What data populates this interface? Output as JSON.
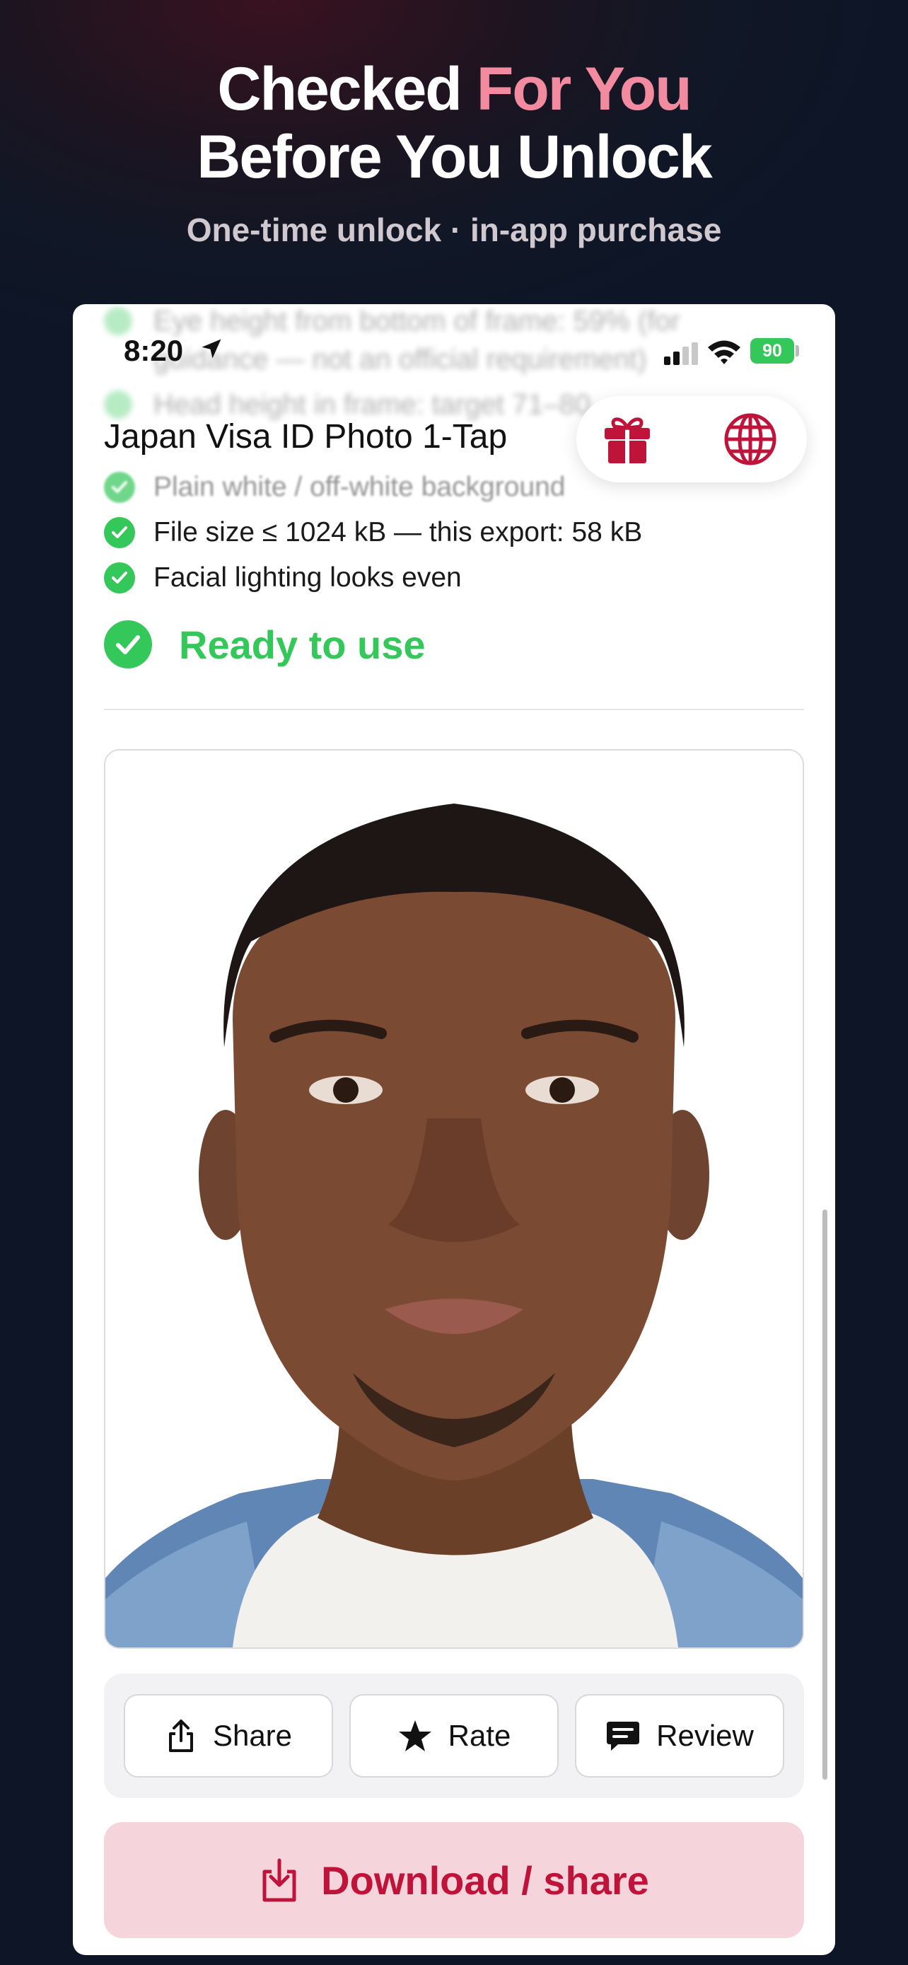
{
  "headline": {
    "line1_plain": "Checked ",
    "line1_accent": "For You",
    "line2": "Before You Unlock"
  },
  "subheadline": "One-time unlock · in-app purchase",
  "status_bar": {
    "time": "8:20",
    "battery": "90"
  },
  "app": {
    "title": "Japan Visa ID Photo 1-Tap"
  },
  "obscured_lines": [
    "Eye height from bottom of frame: 59% (for",
    "guidance — not an official requirement)",
    "Head height in frame: target 71–80"
  ],
  "checks": [
    "Plain white / off-white background",
    "File size ≤ 1024 kB — this export: 58 kB",
    "Facial lighting looks even"
  ],
  "status_message": "Ready to use",
  "actions": {
    "share": "Share",
    "rate": "Rate",
    "review": "Review"
  },
  "download_label": "Download / share",
  "colors": {
    "accent_pink": "#f28aa0",
    "success_green": "#34c759",
    "brand_red": "#c0133a",
    "download_bg": "#f6d4db"
  },
  "icons": [
    "location-arrow-icon",
    "signal-icon",
    "wifi-icon",
    "gift-icon",
    "globe-icon",
    "checkmark-icon",
    "share-icon",
    "star-icon",
    "message-icon",
    "download-icon"
  ]
}
